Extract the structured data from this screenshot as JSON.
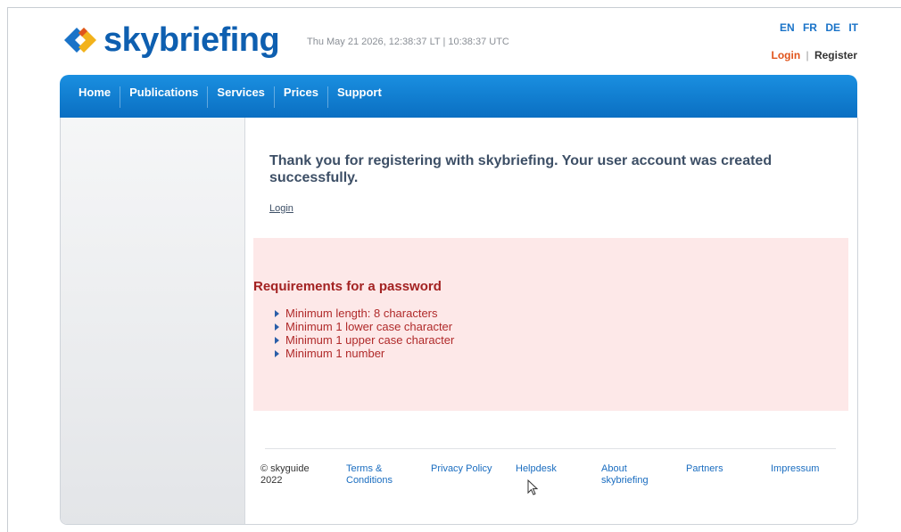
{
  "header": {
    "logo_text": "skybriefing",
    "datetime": "Thu May 21 2026, 12:38:37 LT | 10:38:37 UTC",
    "languages": [
      "EN",
      "FR",
      "DE",
      "IT"
    ],
    "login_label": "Login",
    "separator": "|",
    "register_label": "Register"
  },
  "nav": {
    "items": [
      "Home",
      "Publications",
      "Services",
      "Prices",
      "Support"
    ]
  },
  "main": {
    "message": "Thank you for registering with skybriefing. Your user account was created successfully.",
    "login_link": "Login",
    "requirements": {
      "title": "Requirements for a password",
      "items": [
        "Minimum length: 8 characters",
        "Minimum 1 lower case character",
        "Minimum 1 upper case character",
        "Minimum 1 number"
      ]
    }
  },
  "footer": {
    "copyright": "© skyguide 2022",
    "links": [
      "Terms & Conditions",
      "Privacy Policy",
      "Helpdesk",
      "About skybriefing",
      "Partners",
      "Impressum"
    ]
  },
  "colors": {
    "brand_blue": "#0e5fb0",
    "nav_blue": "#0a6fc2",
    "login_orange": "#e0541b",
    "requirements_bg": "#fde8e8",
    "requirements_text": "#b02a2a"
  }
}
